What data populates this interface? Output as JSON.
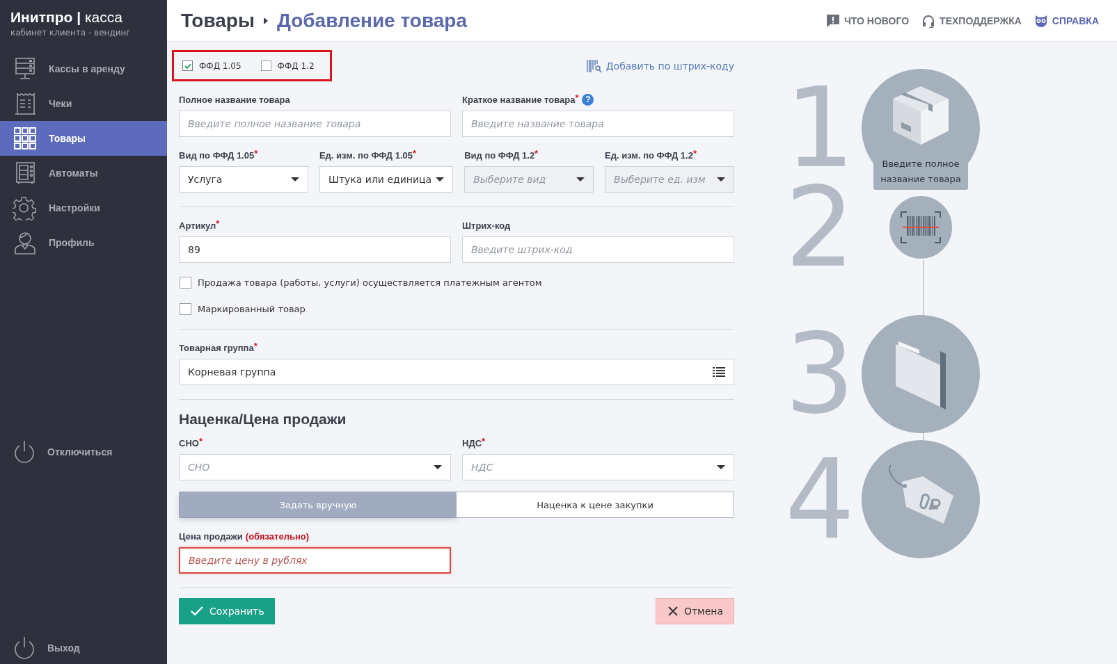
{
  "brand": {
    "name": "Инитпро",
    "separator": "|",
    "product": "касса",
    "subtitle": "кабинет клиента - вендинг"
  },
  "sidebar": {
    "items": [
      {
        "label": "Кассы в аренду",
        "selected": false
      },
      {
        "label": "Чеки",
        "selected": false
      },
      {
        "label": "Товары",
        "selected": true
      },
      {
        "label": "Автоматы",
        "selected": false
      },
      {
        "label": "Настройки",
        "selected": false
      },
      {
        "label": "Профиль",
        "selected": false
      }
    ],
    "disconnect": {
      "label": "Отключиться"
    },
    "exit": {
      "label": "Выход"
    }
  },
  "header": {
    "breadcrumb": [
      "Товары",
      "Добавление товара"
    ],
    "links": [
      {
        "label": "ЧТО НОВОГО",
        "color": "#6b6f78"
      },
      {
        "label": "ТЕХПОДДЕРЖКА",
        "color": "#6b6f78"
      },
      {
        "label": "СПРАВКА",
        "color": "#5b66b3"
      }
    ]
  },
  "form": {
    "versions": [
      {
        "label": "ФФД 1.05",
        "checked": true
      },
      {
        "label": "ФФД 1.2",
        "checked": false
      }
    ],
    "barcode_link": "Добавить по штрих-коду",
    "sections": [
      {
        "kind": "fields",
        "fields": [
          {
            "label": "Полное название товара",
            "kind": "input",
            "placeholder": "Введите полное название товара"
          },
          {
            "label": "Краткое название товара",
            "required": "*",
            "help": "?",
            "kind": "input",
            "placeholder": "Введите название товара"
          }
        ]
      },
      {
        "kind": "fields",
        "fields": [
          {
            "label": "Вид по ФФД 1.05",
            "required": "*",
            "kind": "select",
            "value": "Услуга",
            "disabled": false
          },
          {
            "label": "Ед. изм. по ФФД 1.05",
            "required": "*",
            "kind": "select",
            "value": "Штука или единица",
            "disabled": false
          },
          {
            "label": "Вид по ФФД 1.2",
            "required": "*",
            "kind": "select",
            "placeholder": "Выберите вид",
            "disabled": true
          },
          {
            "label": "Ед. изм. по ФФД 1.2",
            "required": "*",
            "kind": "select",
            "placeholder": "Выберите ед. изм",
            "disabled": true
          }
        ]
      },
      {
        "kind": "divider"
      },
      {
        "kind": "fields",
        "fields": [
          {
            "label": "Артикул",
            "required": "*",
            "kind": "input",
            "value": "89"
          },
          {
            "label": "Штрих-код",
            "kind": "input",
            "placeholder": "Введите штрих-код"
          }
        ]
      },
      {
        "kind": "checkbox",
        "label": "Продажа товара (работы, услуги) осуществляется платежным агентом",
        "checked": false
      },
      {
        "kind": "checkbox",
        "label": "Маркированный товар",
        "checked": false
      },
      {
        "kind": "divider"
      },
      {
        "kind": "fields",
        "fields": [
          {
            "label": "Товарная группа",
            "required": "*",
            "kind": "list",
            "value": "Корневая группа"
          }
        ]
      },
      {
        "kind": "divider"
      },
      {
        "kind": "heading",
        "text": "Наценка/Цена продажи"
      },
      {
        "kind": "fields",
        "fields": [
          {
            "label": "СНО",
            "required": "*",
            "kind": "select",
            "placeholder": "СНО",
            "disabled": false
          },
          {
            "label": "НДС",
            "required": "*",
            "kind": "select",
            "placeholder": "НДС",
            "disabled": false
          }
        ]
      },
      {
        "kind": "toggle",
        "options": [
          {
            "label": "Задать вручную",
            "selected": true
          },
          {
            "label": "Наценка к цене закупки",
            "selected": false
          }
        ]
      },
      {
        "kind": "fields",
        "fields": [
          {
            "label": "Цена продажи",
            "note": "(обязательно)",
            "kind": "input",
            "placeholder": "Введите цену в рублях",
            "error": true
          }
        ]
      },
      {
        "kind": "divider"
      },
      {
        "kind": "actions",
        "save": "Сохранить",
        "cancel": "Отмена"
      }
    ]
  },
  "steps": [
    {
      "number": "1",
      "tooltip": "Введите полное название товара"
    },
    {
      "number": "2"
    },
    {
      "number": "3"
    },
    {
      "number": "4"
    }
  ]
}
